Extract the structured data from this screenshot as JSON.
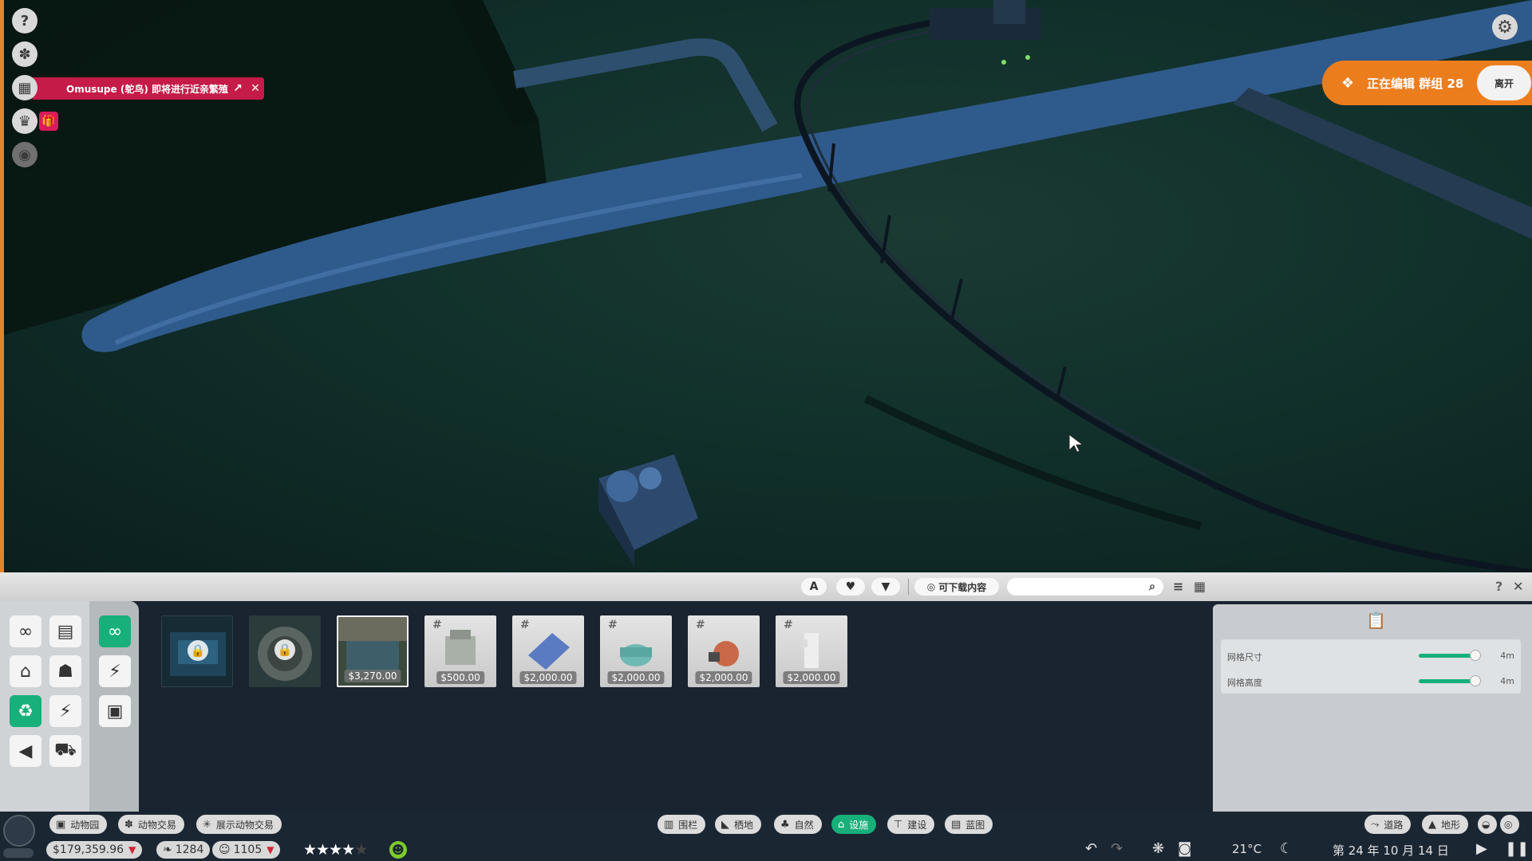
{
  "left_icons": [
    "help-icon",
    "paw-icon",
    "calendar-icon",
    "trophy-icon",
    "eye-icon"
  ],
  "notification": {
    "text": "Omusupe (鸵鸟) 即将进行近亲繁殖",
    "external_icon": "↗",
    "close_icon": "✕"
  },
  "edit_banner": {
    "text": "正在编辑 群组 28",
    "leave_label": "离开"
  },
  "toolbar": {
    "filter_icons": [
      "font-icon",
      "heart-icon",
      "filter-icon"
    ],
    "dlc_label": "可下载内容",
    "search_placeholder": "",
    "right_icons": [
      "sort-icon",
      "grid-icon"
    ],
    "help": "?",
    "close": "✕"
  },
  "catalog": {
    "items": [
      {
        "name": "locked-item-1",
        "locked": true,
        "price": ""
      },
      {
        "name": "locked-item-2",
        "locked": true,
        "price": ""
      },
      {
        "name": "selected-item",
        "locked": false,
        "price": "$3,270.00"
      },
      {
        "name": "generator",
        "locked": false,
        "price": "$500.00"
      },
      {
        "name": "solar-panel",
        "locked": false,
        "price": "$2,000.00"
      },
      {
        "name": "water-tank",
        "locked": false,
        "price": "$2,000.00"
      },
      {
        "name": "boiler",
        "locked": false,
        "price": "$2,000.00"
      },
      {
        "name": "pump",
        "locked": false,
        "price": "$2,000.00"
      }
    ]
  },
  "settings": {
    "grid_size_label": "网格尺寸",
    "grid_size_value": "4m",
    "grid_height_label": "网格高度",
    "grid_height_value": "4m"
  },
  "bottom_left_tabs": [
    "动物园",
    "动物交易",
    "展示动物交易"
  ],
  "bottom_center_tabs": [
    "围栏",
    "栖地",
    "自然",
    "设施",
    "建设",
    "蓝图"
  ],
  "bottom_right_tabs": [
    "道路",
    "地形"
  ],
  "status": {
    "money": "$179,359.96",
    "conservation": "1284",
    "guests": "1105",
    "rating_stars": 4,
    "rating_max": 5,
    "temperature": "21°C",
    "date": "第 24 年 10 月 14 日"
  },
  "colors": {
    "accent_green": "#17b07a",
    "banner_orange": "#ec7d1d",
    "notification_red": "#c41b48"
  }
}
